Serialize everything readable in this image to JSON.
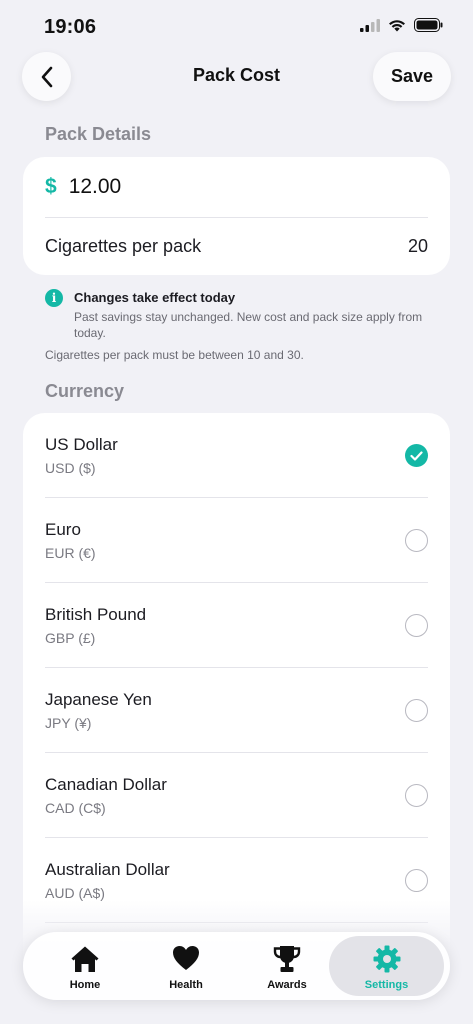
{
  "status_bar": {
    "time": "19:06"
  },
  "header": {
    "title": "Pack Cost",
    "save_label": "Save"
  },
  "pack_details": {
    "section_title": "Pack Details",
    "currency_symbol": "$",
    "price": "12.00",
    "per_pack_label": "Cigarettes per pack",
    "per_pack_value": "20"
  },
  "notice": {
    "title": "Changes take effect today",
    "body": "Past savings stay unchanged. New cost and pack size apply from today.",
    "range_note": "Cigarettes per pack must be between 10 and 30."
  },
  "currency": {
    "section_title": "Currency",
    "options": [
      {
        "name": "US Dollar",
        "code": "USD ($)",
        "selected": true
      },
      {
        "name": "Euro",
        "code": "EUR (€)",
        "selected": false
      },
      {
        "name": "British Pound",
        "code": "GBP (£)",
        "selected": false
      },
      {
        "name": "Japanese Yen",
        "code": "JPY (¥)",
        "selected": false
      },
      {
        "name": "Canadian Dollar",
        "code": "CAD (C$)",
        "selected": false
      },
      {
        "name": "Australian Dollar",
        "code": "AUD (A$)",
        "selected": false
      }
    ]
  },
  "tab_bar": {
    "tabs": [
      {
        "label": "Home",
        "icon": "home-icon",
        "active": false
      },
      {
        "label": "Health",
        "icon": "heart-icon",
        "active": false
      },
      {
        "label": "Awards",
        "icon": "trophy-icon",
        "active": false
      },
      {
        "label": "Settings",
        "icon": "gear-icon",
        "active": true
      }
    ]
  },
  "colors": {
    "accent": "#14b8a6",
    "background": "#f1f1f6"
  }
}
